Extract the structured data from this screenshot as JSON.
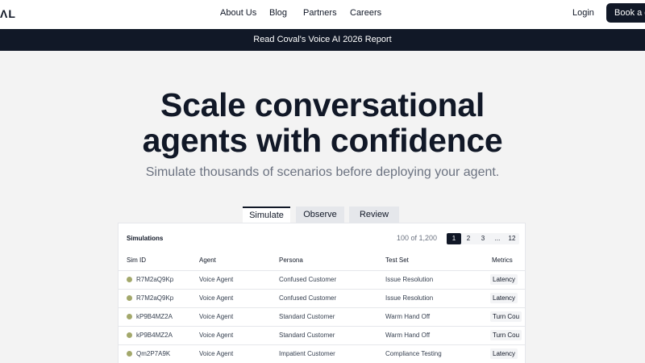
{
  "nav": {
    "logo": "ΛL",
    "links": [
      "About Us",
      "Blog",
      "Partners",
      "Careers"
    ],
    "login": "Login",
    "book": "Book a d"
  },
  "banner": "Read Coval's Voice AI 2026 Report",
  "hero": {
    "title_line1": "Scale conversational",
    "title_line2": "agents with confidence",
    "subtitle": "Simulate thousands of scenarios before deploying your agent."
  },
  "tabs": [
    "Simulate",
    "Observe",
    "Review"
  ],
  "simulations": {
    "title": "Simulations",
    "count": "100 of 1,200",
    "pages": [
      "1",
      "2",
      "3",
      "...",
      "12"
    ],
    "columns": [
      "Sim ID",
      "Agent",
      "Persona",
      "Test Set",
      "Metrics"
    ],
    "rows": [
      [
        "R7M2aQ9Kp",
        "Voice Agent",
        "Confused Customer",
        "Issue Resolution",
        "Latency"
      ],
      [
        "R7M2aQ9Kp",
        "Voice Agent",
        "Confused Customer",
        "Issue Resolution",
        "Latency"
      ],
      [
        "kP9B4MZ2A",
        "Voice Agent",
        "Standard Customer",
        "Warm Hand Off",
        "Turn Cou"
      ],
      [
        "kP9B4MZ2A",
        "Voice Agent",
        "Standard Customer",
        "Warm Hand Off",
        "Turn Cou"
      ],
      [
        "Qm2P7A9K",
        "Voice Agent",
        "Impatient Customer",
        "Compliance Testing",
        "Latency"
      ]
    ],
    "status_color": "#a3a86b"
  },
  "colors": {
    "dark": "#111827",
    "bg": "#f3f3f3",
    "muted": "#6b7280"
  }
}
